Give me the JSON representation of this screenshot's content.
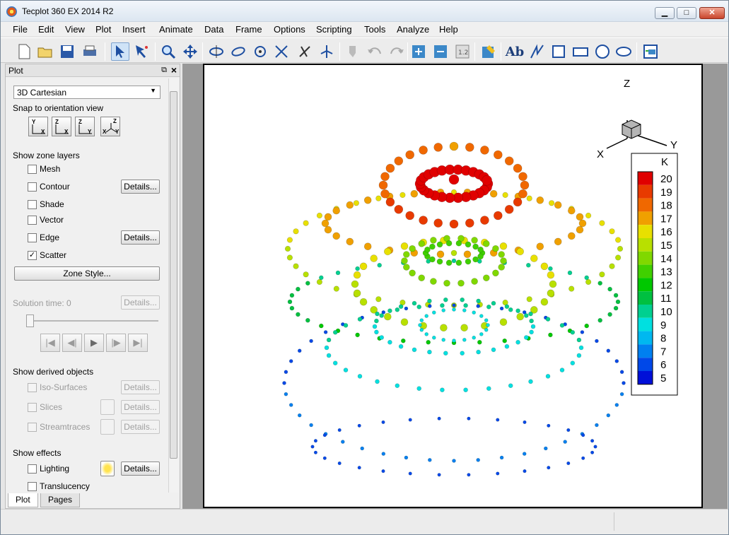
{
  "window": {
    "title": "Tecplot 360 EX 2014 R2",
    "minimize": "▁",
    "maximize": "□",
    "close": "✕"
  },
  "menu": [
    "File",
    "Edit",
    "View",
    "Plot",
    "Insert",
    "Animate",
    "Data",
    "Frame",
    "Options",
    "Scripting",
    "Tools",
    "Analyze",
    "Help"
  ],
  "toolbar": {
    "icons": [
      "new-layout-icon",
      "open-icon",
      "save-icon",
      "print-icon",
      "selector-icon",
      "adjustor-icon",
      "zoom-icon",
      "translate-icon",
      "rotate-x-icon",
      "rotate-y-icon",
      "rotate-z-icon",
      "rotate-3d-icon",
      "orient-x-icon",
      "orient-y-icon",
      "probe-icon",
      "undo-icon",
      "redo-icon",
      "add-zone-icon",
      "remove-zone-icon",
      "field-icon",
      "slice-icon",
      "text-icon",
      "polyline-icon",
      "square-icon",
      "rectangle-icon",
      "circle-icon",
      "ellipse-icon",
      "frame-icon"
    ],
    "text_tool_label": "Ab"
  },
  "sidebar": {
    "title": "Plot",
    "plot_type": "3D Cartesian",
    "snap_label": "Snap to orientation view",
    "orient_buttons": [
      [
        "Y",
        "X"
      ],
      [
        "Z",
        "X"
      ],
      [
        "Z",
        "Y"
      ],
      [
        "Z",
        "X",
        "Y"
      ]
    ],
    "zone_layers_label": "Show zone layers",
    "layers": [
      {
        "label": "Mesh",
        "checked": false
      },
      {
        "label": "Contour",
        "checked": false,
        "details": "Details..."
      },
      {
        "label": "Shade",
        "checked": false
      },
      {
        "label": "Vector",
        "checked": false
      },
      {
        "label": "Edge",
        "checked": false,
        "details": "Details..."
      },
      {
        "label": "Scatter",
        "checked": true
      }
    ],
    "zone_style": "Zone Style...",
    "solution_time": "Solution time:  0",
    "details": "Details...",
    "derived_label": "Show derived objects",
    "derived": [
      "Iso-Surfaces",
      "Slices",
      "Streamtraces"
    ],
    "effects_label": "Show effects",
    "effects": [
      "Lighting",
      "Translucency"
    ],
    "check_mark": "✓",
    "tabs": [
      "Plot",
      "Pages"
    ]
  },
  "plot": {
    "axis_labels": {
      "z": "Z",
      "x": "X",
      "y": "Y"
    },
    "legend": {
      "title": "K",
      "levels": [
        "20",
        "19",
        "18",
        "17",
        "16",
        "15",
        "14",
        "13",
        "12",
        "11",
        "10",
        "9",
        "8",
        "7",
        "6",
        "5"
      ],
      "colors": [
        "#e00000",
        "#e83a00",
        "#f06800",
        "#f0a000",
        "#e8e000",
        "#b8e000",
        "#80d800",
        "#40d000",
        "#00c800",
        "#00c040",
        "#00d090",
        "#00e0e0",
        "#00b8f0",
        "#0080f0",
        "#0048e8",
        "#0010d8"
      ]
    }
  },
  "chart_data": {
    "type": "scatter",
    "title": "",
    "color_variable": "K",
    "series": [
      {
        "name": "",
        "level": "top",
        "ring_radius": "outer",
        "K": 17.5
      },
      {
        "name": "",
        "level": "top",
        "ring_radius": "inner",
        "K": 20
      },
      {
        "name": "",
        "level": "middle",
        "ring_radius": "outer",
        "K": 15
      },
      {
        "name": "",
        "level": "middle",
        "ring_radius": "inner",
        "K": 13.5
      },
      {
        "name": "",
        "level": "bottom",
        "ring_radius": "outer",
        "K": 9
      },
      {
        "name": "",
        "level": "bottom",
        "ring_radius": "inner",
        "K": 9.5
      }
    ],
    "clim": [
      5,
      20
    ]
  }
}
